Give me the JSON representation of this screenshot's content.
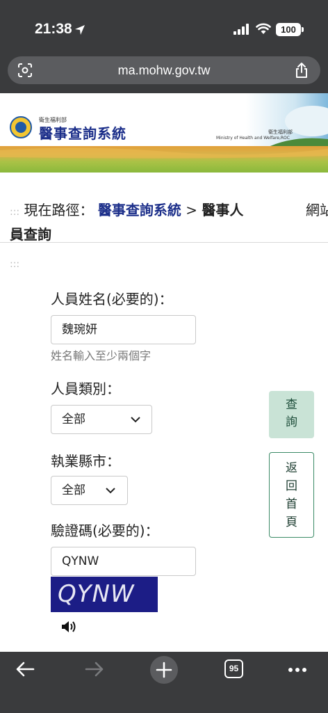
{
  "status_bar": {
    "time": "21:38",
    "battery": "100"
  },
  "browser": {
    "url": "ma.mohw.gov.tw",
    "tab_count": "95"
  },
  "banner": {
    "ministry_small": "衛生福利部",
    "site_title": "醫事查詢系統",
    "ministry_cn": "衛生福利部",
    "ministry_en": "Ministry of Health and Welfare,ROC"
  },
  "breadcrumb": {
    "dots": ":::",
    "prefix": "現在路徑：",
    "link": "醫事查詢系統",
    "separator": ">",
    "current_line1": "醫事人",
    "current_line2": "員查詢",
    "right_text": "網站"
  },
  "section_dots": ":::",
  "form": {
    "name_label": "人員姓名(必要的)：",
    "name_value": "魏琬妍",
    "name_hint": "姓名輸入至少兩個字",
    "category_label": "人員類別：",
    "category_value": "全部",
    "county_label": "執業縣市：",
    "county_value": "全部",
    "captcha_label": "驗證碼(必要的)：",
    "captcha_value": "QYNW",
    "captcha_image_text": "QYNW"
  },
  "buttons": {
    "query": [
      "查",
      "詢"
    ],
    "home": [
      "返",
      "回",
      "首",
      "頁"
    ]
  },
  "colors": {
    "browser_chrome": "#3a3b3d",
    "title_blue": "#1c2f8a",
    "query_bg": "#c9e3d6",
    "home_border": "#3b8a66",
    "captcha_bg": "#1c1d86"
  }
}
